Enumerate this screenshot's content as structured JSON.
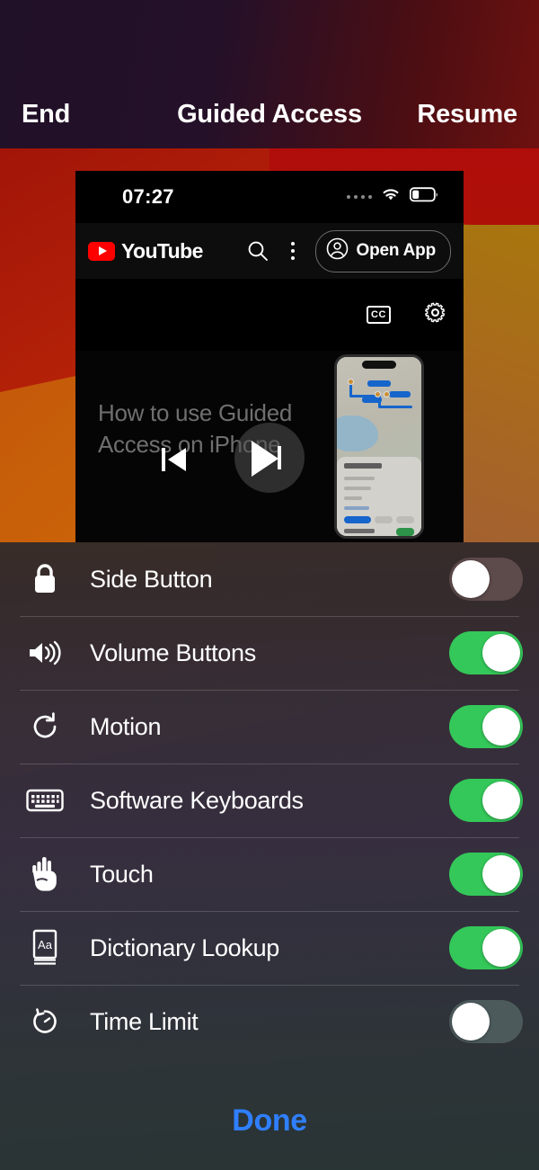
{
  "topbar": {
    "end_label": "End",
    "title": "Guided Access",
    "resume_label": "Resume"
  },
  "app_window": {
    "status_bar": {
      "time": "07:27",
      "cellular_icon": "cellular-dots-icon",
      "wifi_icon": "wifi-icon",
      "battery_icon": "battery-low-icon"
    },
    "youtube_bar": {
      "logo_icon": "youtube-logo-icon",
      "wordmark": "YouTube",
      "search_icon": "search-icon",
      "more_icon": "kebab-menu-icon",
      "open_app_label": "Open App",
      "account_icon": "account-circle-icon"
    },
    "player_controls": {
      "captions_label": "CC",
      "captions_icon": "closed-captions-icon",
      "settings_icon": "gear-icon",
      "previous_icon": "previous-track-icon",
      "play_icon": "play-icon",
      "next_icon": "next-track-icon"
    },
    "video": {
      "title": "How to use Guided Access on iPhone",
      "thumbnail_icon": "iphone-maps-thumbnail"
    }
  },
  "panel": {
    "rows": [
      {
        "icon": "lock-icon",
        "label": "Side Button",
        "toggle": "off",
        "toggle_style": "off-warm"
      },
      {
        "icon": "volume-icon",
        "label": "Volume Buttons",
        "toggle": "on",
        "toggle_style": "on"
      },
      {
        "icon": "rotate-icon",
        "label": "Motion",
        "toggle": "on",
        "toggle_style": "on"
      },
      {
        "icon": "keyboard-icon",
        "label": "Software Keyboards",
        "toggle": "on",
        "toggle_style": "on"
      },
      {
        "icon": "touch-hand-icon",
        "label": "Touch",
        "toggle": "on",
        "toggle_style": "on"
      },
      {
        "icon": "dictionary-icon",
        "label": "Dictionary Lookup",
        "toggle": "on",
        "toggle_style": "on"
      },
      {
        "icon": "timer-icon",
        "label": "Time Limit",
        "toggle": "off",
        "toggle_style": "off-cool"
      }
    ],
    "done_label": "Done"
  },
  "colors": {
    "toggle_on": "#34c759",
    "toggle_off_warm": "#5d4a4a",
    "toggle_off_cool": "#4c5a5c",
    "done_blue": "#2f7fff",
    "youtube_red": "#ff0000",
    "text_primary": "#ffffff",
    "video_title_gray": "#6f6f6f"
  }
}
